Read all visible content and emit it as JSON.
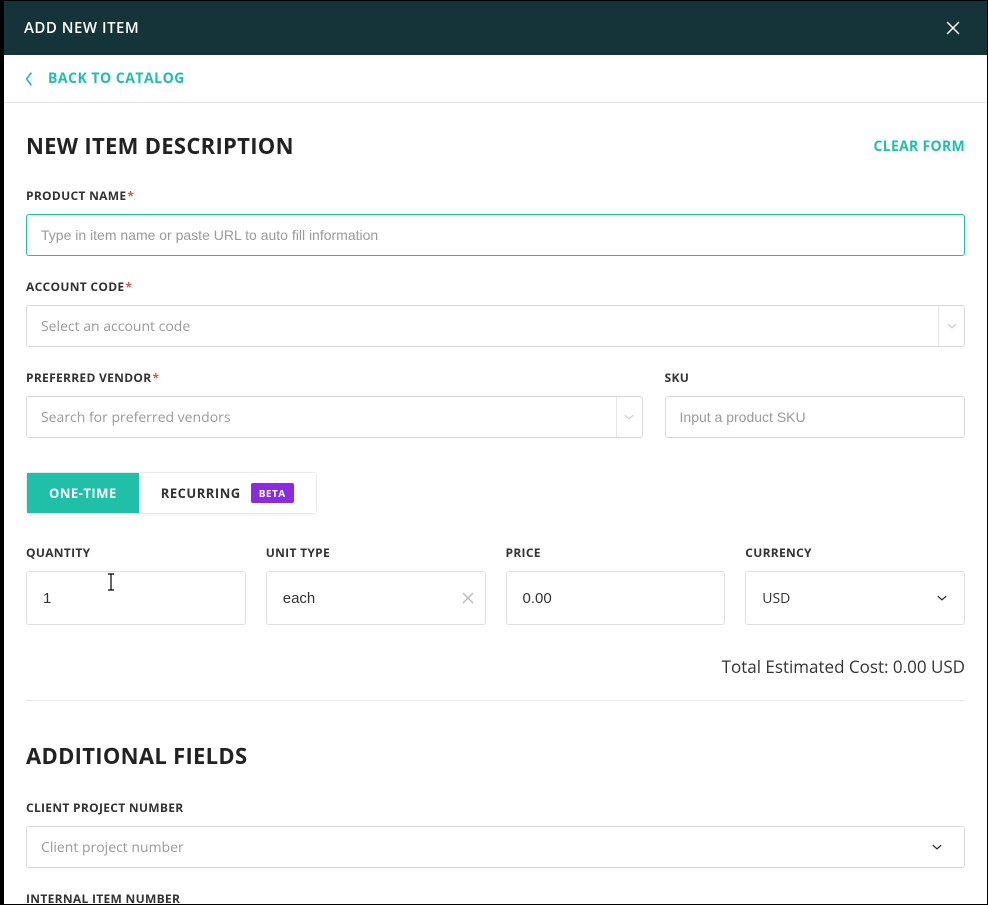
{
  "header": {
    "title": "ADD NEW ITEM"
  },
  "backLink": {
    "label": "BACK TO CATALOG"
  },
  "section": {
    "title": "NEW ITEM DESCRIPTION",
    "clear": "CLEAR FORM"
  },
  "fields": {
    "productName": {
      "label": "PRODUCT NAME",
      "placeholder": "Type in item name or paste URL to auto fill information",
      "required": "*"
    },
    "accountCode": {
      "label": "ACCOUNT CODE",
      "placeholder": "Select an account code",
      "required": "*"
    },
    "preferredVendor": {
      "label": "PREFERRED VENDOR",
      "placeholder": "Search for preferred vendors",
      "required": "*"
    },
    "sku": {
      "label": "SKU",
      "placeholder": "Input a product SKU"
    }
  },
  "tabs": {
    "oneTime": "ONE-TIME",
    "recurring": "RECURRING",
    "beta": "BETA"
  },
  "lineFields": {
    "quantity": {
      "label": "QUANTITY",
      "value": "1"
    },
    "unitType": {
      "label": "UNIT TYPE",
      "value": "each"
    },
    "price": {
      "label": "PRICE",
      "value": "0.00"
    },
    "currency": {
      "label": "CURRENCY",
      "value": "USD"
    }
  },
  "total": {
    "label": "Total Estimated Cost:",
    "value": "0.00 USD"
  },
  "additional": {
    "title": "ADDITIONAL FIELDS",
    "clientProjectNumber": {
      "label": "CLIENT PROJECT NUMBER",
      "placeholder": "Client project number"
    },
    "internalItemNumber": {
      "label": "INTERNAL ITEM NUMBER"
    }
  }
}
